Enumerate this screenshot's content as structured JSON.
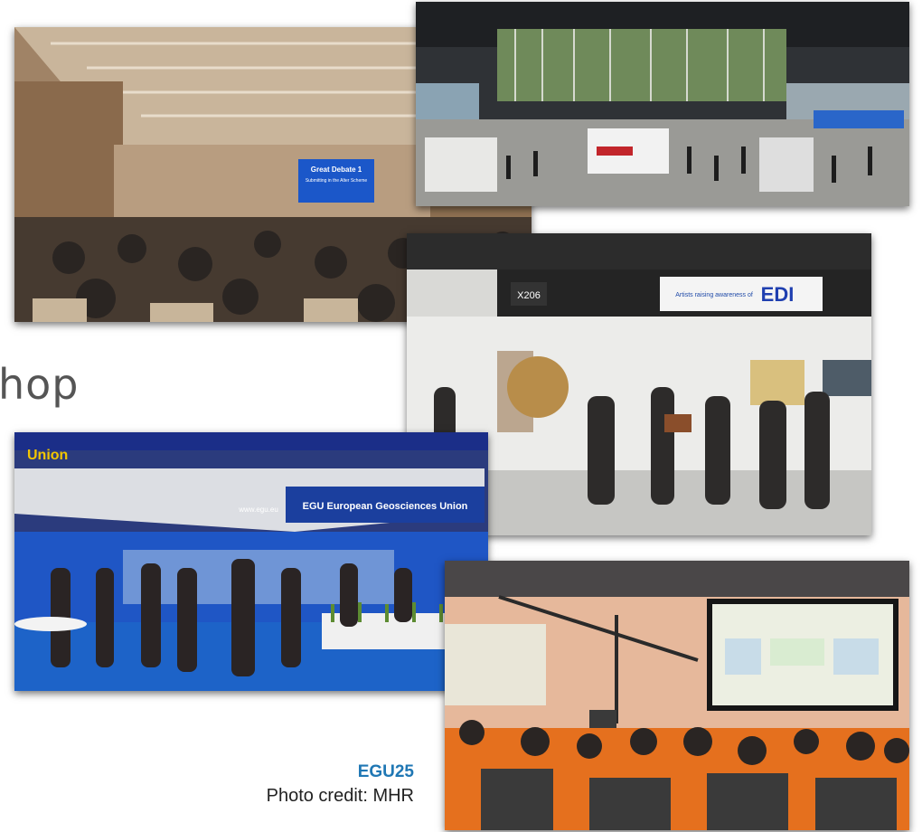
{
  "slide": {
    "partial_heading": "hop",
    "event_label": "EGU25",
    "photo_credit": "Photo credit: MHR"
  },
  "photos": {
    "lecture_hall": {
      "screen_title": "Great Debate 1",
      "screen_sub": "Submitting in the Alter Scheme"
    },
    "edi_booth": {
      "sign_code": "X206",
      "sign_text": "Artists raising awareness of",
      "sign_logo": "EDI"
    },
    "egu_booth": {
      "banner": "EGU European Geosciences Union",
      "site": "www.egu.eu",
      "corner": "Union"
    },
    "talk_room": {}
  },
  "colors": {
    "accent": "#1f77b4",
    "egu_blue": "#1b3f9e",
    "floor_blue": "#1d63c8",
    "stage_orange": "#e4701e"
  }
}
